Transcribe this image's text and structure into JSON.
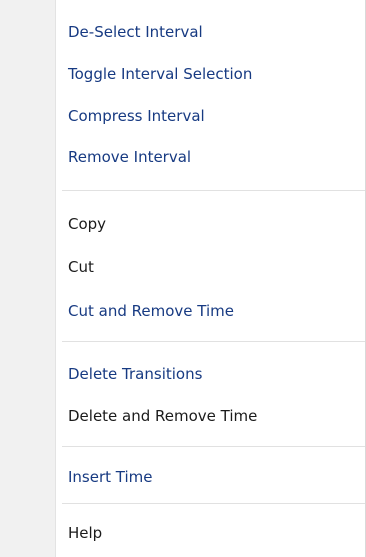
{
  "menu": {
    "items": [
      {
        "label": "De-Select Interval"
      },
      {
        "label": "Toggle Interval Selection"
      },
      {
        "label": "Compress Interval"
      },
      {
        "label": "Remove Interval"
      },
      {
        "label": "Copy"
      },
      {
        "label": "Cut"
      },
      {
        "label": "Cut and Remove Time"
      },
      {
        "label": "Delete Transitions"
      },
      {
        "label": "Delete and Remove Time"
      },
      {
        "label": "Insert Time"
      },
      {
        "label": "Help"
      }
    ]
  },
  "colors": {
    "gutter": "#f1f1f1",
    "accent_text": "#173a82",
    "plain_text": "#1b1b1b",
    "separator": "#e1e1e1"
  }
}
